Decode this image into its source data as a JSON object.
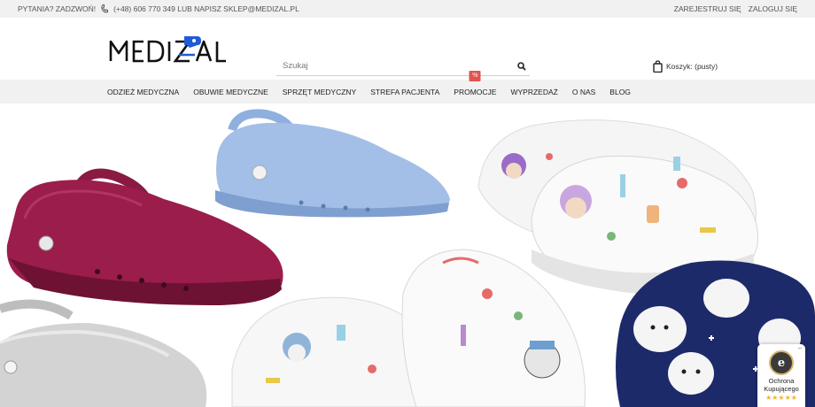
{
  "topbar": {
    "call_label": "PYTANIA? ZADZWOŃ!",
    "phone_icon": "phone-icon",
    "contact_text": "(+48) 606 770 349 LUB NAPISZ SKLEP@MEDIZAL.PL",
    "register_label": "ZAREJESTRUJ SIĘ",
    "login_label": "ZALOGUJ SIĘ"
  },
  "header": {
    "logo_text": "MEDIZAL",
    "search_placeholder": "Szukaj",
    "search_icon": "search-icon",
    "cart_icon": "shopping-bag-icon",
    "cart_label": "Koszyk: (pusty)"
  },
  "nav": {
    "items": [
      {
        "label": "ODZIEŻ MEDYCZNA"
      },
      {
        "label": "OBUWIE MEDYCZNE"
      },
      {
        "label": "SPRZĘT MEDYCZNY"
      },
      {
        "label": "STREFA PACJENTA"
      },
      {
        "label": "PROMOCJE",
        "badge": "%"
      },
      {
        "label": "WYPRZEDAŻ"
      },
      {
        "label": "O NAS"
      },
      {
        "label": "BLOG"
      }
    ]
  },
  "trust_badge": {
    "menu": "···",
    "seal_letter": "e",
    "label_line1": "Ochrona",
    "label_line2": "Kupującego",
    "stars": "★★★★★",
    "rating": 5
  },
  "colors": {
    "topbar_bg": "#f1f1f1",
    "brand_blue": "#1f5bd8",
    "promo_red": "#e2534d",
    "star_gold": "#f6b42a"
  }
}
